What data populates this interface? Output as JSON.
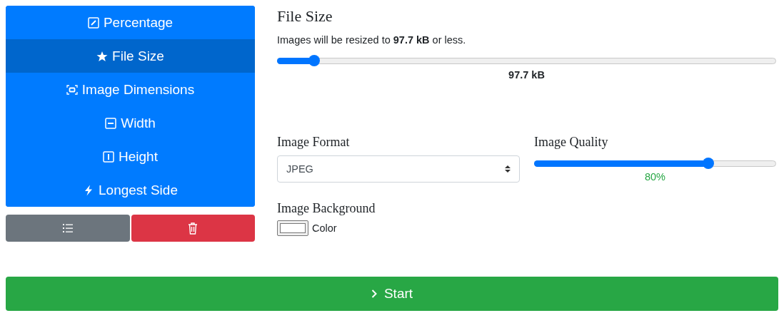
{
  "modes": [
    {
      "label": "Percentage",
      "selected": false
    },
    {
      "label": "File Size",
      "selected": true
    },
    {
      "label": "Image Dimensions",
      "selected": false
    },
    {
      "label": "Width",
      "selected": false
    },
    {
      "label": "Height",
      "selected": false
    },
    {
      "label": "Longest Side",
      "selected": false
    }
  ],
  "panel": {
    "title": "File Size",
    "description": "Images will be resized to **97.7 kB** or less.",
    "slider": {
      "level": 0.075
    },
    "reading": "97.7 kB"
  },
  "format": {
    "label": "Image Format",
    "value": "JPEG"
  },
  "quality": {
    "label": "Image Quality",
    "level": 0.72,
    "reading": "80%"
  },
  "background": {
    "label": "Image Background",
    "color_label": "Color"
  },
  "start_button": {
    "label": "Start"
  }
}
